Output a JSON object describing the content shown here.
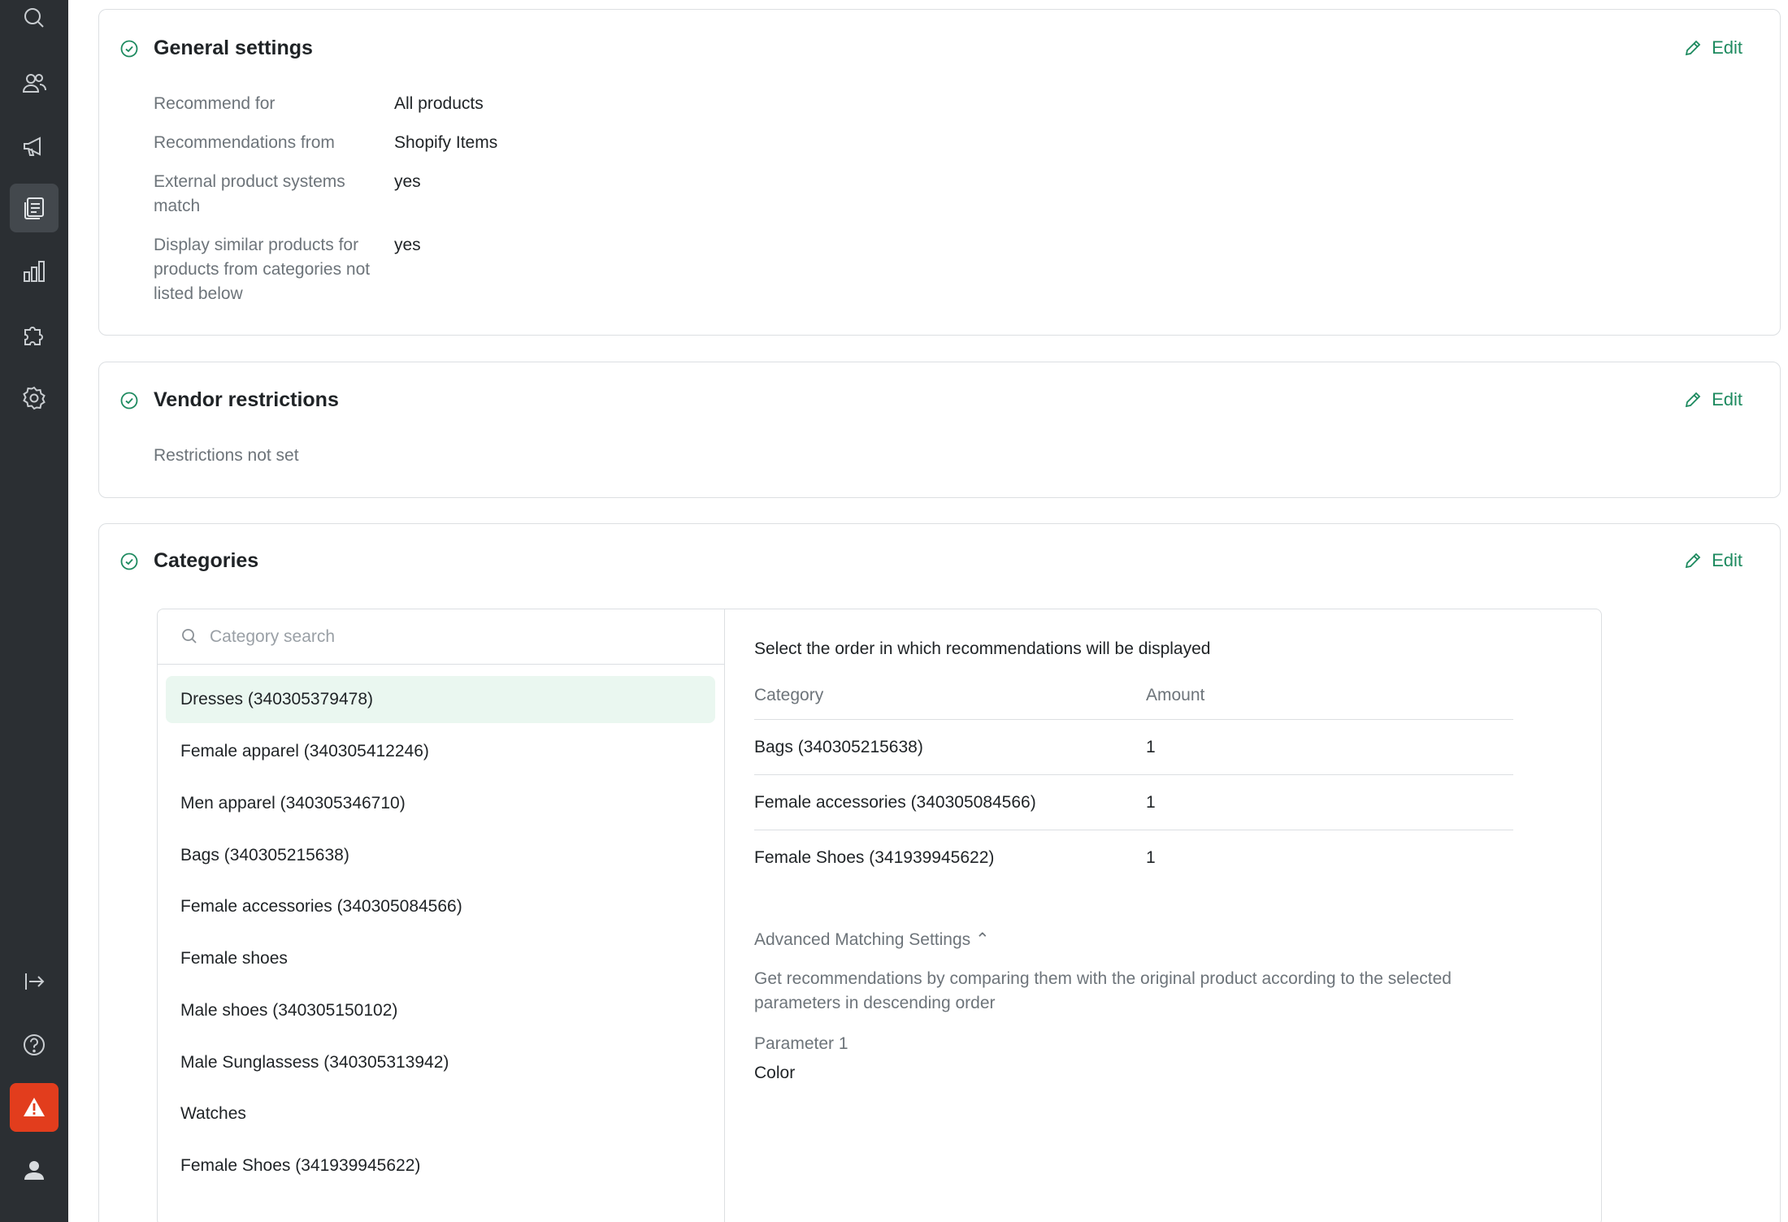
{
  "sidebar": {
    "items": [
      {
        "icon": "search-icon"
      },
      {
        "icon": "users-icon"
      },
      {
        "icon": "megaphone-icon"
      },
      {
        "icon": "recommendations-icon",
        "active": true
      },
      {
        "icon": "analytics-icon"
      },
      {
        "icon": "integrations-icon"
      },
      {
        "icon": "settings-icon"
      }
    ],
    "bottom": [
      {
        "icon": "collapse-sidebar-icon"
      },
      {
        "icon": "help-icon"
      },
      {
        "icon": "alert-icon"
      },
      {
        "icon": "profile-icon"
      }
    ]
  },
  "colors": {
    "sidebar_bg": "#2b2f33",
    "accent": "#1d8a5f",
    "alert": "#e23d1d",
    "selected_bg": "#eaf7f0"
  },
  "general": {
    "title": "General settings",
    "edit_label": "Edit",
    "rows": [
      {
        "key": "Recommend for",
        "value": "All products"
      },
      {
        "key": "Recommendations from",
        "value": "Shopify Items"
      },
      {
        "key": "External product systems match",
        "value": "yes"
      },
      {
        "key": "Display similar products for products from categories not listed below",
        "value": "yes"
      }
    ]
  },
  "vendor": {
    "title": "Vendor restrictions",
    "edit_label": "Edit",
    "status": "Restrictions not set"
  },
  "categories": {
    "title": "Categories",
    "edit_label": "Edit",
    "search_placeholder": "Category search",
    "list": [
      "Dresses (340305379478)",
      "Female apparel (340305412246)",
      "Men apparel (340305346710)",
      "Bags (340305215638)",
      "Female accessories (340305084566)",
      "Female shoes",
      "Male shoes (340305150102)",
      "Male Sunglassess (340305313942)",
      "Watches",
      "Female Shoes (341939945622)"
    ],
    "selected_index": 0,
    "order_title": "Select the order in which recommendations will be displayed",
    "table": {
      "headers": {
        "category": "Category",
        "amount": "Amount"
      },
      "rows": [
        {
          "category": "Bags (340305215638)",
          "amount": "1"
        },
        {
          "category": "Female accessories (340305084566)",
          "amount": "1"
        },
        {
          "category": "Female Shoes (341939945622)",
          "amount": "1"
        }
      ]
    },
    "advanced_label": "Advanced Matching Settings ⌃",
    "advanced_desc": "Get recommendations by comparing them with the original product according to the selected parameters in descending order",
    "parameter_label": "Parameter 1",
    "parameter_value": "Color"
  }
}
